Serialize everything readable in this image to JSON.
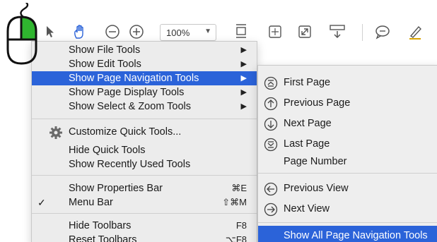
{
  "toolbar": {
    "zoom_value": "100%",
    "icons": [
      "select-arrow-icon",
      "hand-icon",
      "zoom-out-icon",
      "zoom-in-icon",
      "fit-page-icon",
      "rotate-icon",
      "full-screen-icon",
      "scroll-mode-icon",
      "comment-icon",
      "highlight-pen-icon"
    ]
  },
  "main_menu": {
    "items": [
      {
        "label": "Show File Tools",
        "submenu": true
      },
      {
        "label": "Show Edit Tools",
        "submenu": true
      },
      {
        "label": "Show Page Navigation Tools",
        "submenu": true,
        "highlighted": true
      },
      {
        "label": "Show Page Display Tools",
        "submenu": true
      },
      {
        "label": "Show Select & Zoom Tools",
        "submenu": true
      },
      {
        "label": "Customize Quick Tools..."
      },
      {
        "label": "Hide Quick Tools"
      },
      {
        "label": "Show Recently Used Tools"
      },
      {
        "label": "Show Properties Bar",
        "shortcut": "⌘E"
      },
      {
        "label": "Menu Bar",
        "shortcut": "⇧⌘M",
        "checked": true
      },
      {
        "label": "Hide Toolbars",
        "shortcut": "F8"
      },
      {
        "label": "Reset Toolbars",
        "shortcut": "⌥F8"
      }
    ],
    "check_mark": "✓",
    "arrow": "▶"
  },
  "sub_menu": {
    "items": [
      {
        "label": "First Page",
        "icon": "first-page-icon"
      },
      {
        "label": "Previous Page",
        "icon": "previous-page-icon"
      },
      {
        "label": "Next Page",
        "icon": "next-page-icon"
      },
      {
        "label": "Last Page",
        "icon": "last-page-icon"
      },
      {
        "label": "Page Number"
      },
      {
        "label": "Previous View",
        "icon": "previous-view-icon"
      },
      {
        "label": "Next View",
        "icon": "next-view-icon"
      },
      {
        "label": "Show All Page Navigation Tools",
        "highlighted": true
      }
    ]
  },
  "colors": {
    "highlight": "#2b63d9",
    "mouse_button": "#2fb52f",
    "menu_bg": "#ececec"
  }
}
